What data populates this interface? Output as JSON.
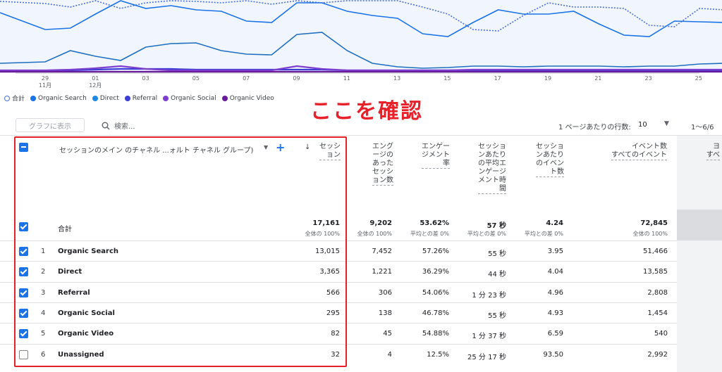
{
  "chart": {
    "x_ticks": [
      {
        "day": "29",
        "month": "11月"
      },
      {
        "day": "01",
        "month": "12月"
      },
      {
        "day": "03",
        "month": ""
      },
      {
        "day": "05",
        "month": ""
      },
      {
        "day": "07",
        "month": ""
      },
      {
        "day": "09",
        "month": ""
      },
      {
        "day": "11",
        "month": ""
      },
      {
        "day": "13",
        "month": ""
      },
      {
        "day": "15",
        "month": ""
      },
      {
        "day": "17",
        "month": ""
      },
      {
        "day": "19",
        "month": ""
      },
      {
        "day": "21",
        "month": ""
      },
      {
        "day": "23",
        "month": ""
      },
      {
        "day": "25",
        "month": ""
      }
    ],
    "colors": {
      "total": "#4a6fd1",
      "organic_search": "#1a73e8",
      "direct": "#1e6fbf",
      "referral": "#3b3fd8",
      "organic_social": "#7e3fd1",
      "organic_video": "#6a1b9a"
    }
  },
  "legend": [
    {
      "label": "合計",
      "color": "#4a6fd1",
      "style": "outline"
    },
    {
      "label": "Organic Search",
      "color": "#1a73e8",
      "style": "fill"
    },
    {
      "label": "Direct",
      "color": "#1e88e5",
      "style": "fill"
    },
    {
      "label": "Referral",
      "color": "#3b3fd8",
      "style": "fill"
    },
    {
      "label": "Organic Social",
      "color": "#7e3fd1",
      "style": "fill"
    },
    {
      "label": "Organic Video",
      "color": "#6a1b9a",
      "style": "fill"
    }
  ],
  "annotation": "ここを確認",
  "toolbar": {
    "graph_button": "グラフに表示",
    "search_placeholder": "検索...",
    "rows_per_page_label": "1 ページあたりの行数:",
    "rows_per_page_value": "10",
    "pagination": "1〜6/6"
  },
  "table": {
    "dimension_header": "セッションのメイン のチャネル ...ォルト チャネル グループ)",
    "headers": [
      "セッシ\nョン",
      "エング\nージの\nあった\nセッシ\nョン数",
      "エンゲー\nジメント\n率",
      "セッショ\nンあたり\nの平均エ\nンゲージ\nメント時\n間",
      "セッショ\nンあたり\nのイベン\nト数",
      "イベント数\nすべてのイベント",
      "ヨ\nすべ"
    ],
    "total": {
      "label": "合計",
      "values": [
        "17,161",
        "9,202",
        "53.62%",
        "57 秒",
        "4.24",
        "72,845"
      ],
      "subs": [
        "全体の 100%",
        "全体の 100%",
        "平均との差 0%",
        "平均との差 0%",
        "平均との差 0%",
        "全体の 100%"
      ]
    },
    "rows": [
      {
        "rank": "1",
        "name": "Organic Search",
        "checked": true,
        "values": [
          "13,015",
          "7,452",
          "57.26%",
          "55 秒",
          "3.95",
          "51,466"
        ]
      },
      {
        "rank": "2",
        "name": "Direct",
        "checked": true,
        "values": [
          "3,365",
          "1,221",
          "36.29%",
          "44 秒",
          "4.04",
          "13,585"
        ]
      },
      {
        "rank": "3",
        "name": "Referral",
        "checked": true,
        "values": [
          "566",
          "306",
          "54.06%",
          "1 分 23 秒",
          "4.96",
          "2,808"
        ]
      },
      {
        "rank": "4",
        "name": "Organic Social",
        "checked": true,
        "values": [
          "295",
          "138",
          "46.78%",
          "55 秒",
          "4.93",
          "1,454"
        ]
      },
      {
        "rank": "5",
        "name": "Organic Video",
        "checked": true,
        "values": [
          "82",
          "45",
          "54.88%",
          "1 分 37 秒",
          "6.59",
          "540"
        ]
      },
      {
        "rank": "6",
        "name": "Unassigned",
        "checked": false,
        "values": [
          "32",
          "4",
          "12.5%",
          "25 分 17 秒",
          "93.50",
          "2,992"
        ]
      }
    ]
  }
}
